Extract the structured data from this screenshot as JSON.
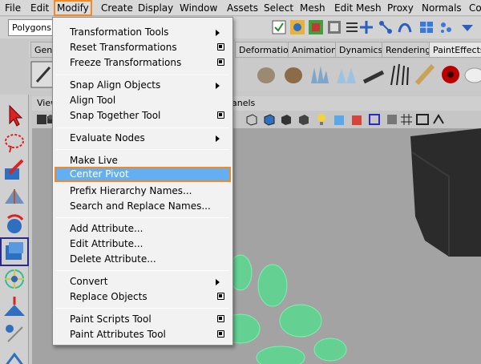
{
  "menubar": {
    "items": [
      "File",
      "Edit",
      "Modify",
      "Create",
      "Display",
      "Window",
      "Assets",
      "Select",
      "Mesh",
      "Edit Mesh",
      "Proxy",
      "Normals",
      "Co"
    ],
    "active": "Modify"
  },
  "toolbar": {
    "mode": "Polygons"
  },
  "shelf_tabs": [
    "Gene",
    "Deformation",
    "Animation",
    "Dynamics",
    "Rendering",
    "PaintEffects"
  ],
  "viewport": {
    "menu_view": "View",
    "menu_panels": "anels"
  },
  "modify_menu": {
    "items": [
      {
        "label": "Transformation Tools",
        "submenu": true
      },
      {
        "label": "Reset Transformations",
        "option_box": true
      },
      {
        "label": "Freeze Transformations",
        "option_box": true
      },
      {
        "label": "Snap Align Objects",
        "submenu": true
      },
      {
        "label": "Align Tool"
      },
      {
        "label": "Snap Together Tool",
        "option_box": true
      },
      {
        "label": "Evaluate Nodes",
        "submenu": true
      },
      {
        "label": "Make Live"
      },
      {
        "label": "Center Pivot",
        "highlighted": true
      },
      {
        "label": "Prefix Hierarchy Names..."
      },
      {
        "label": "Search and Replace Names..."
      },
      {
        "label": "Add Attribute..."
      },
      {
        "label": "Edit Attribute..."
      },
      {
        "label": "Delete Attribute..."
      },
      {
        "label": "Convert",
        "submenu": true
      },
      {
        "label": "Replace Objects",
        "option_box": true
      },
      {
        "label": "Paint Scripts Tool",
        "option_box": true
      },
      {
        "label": "Paint Attributes Tool",
        "option_box": true
      }
    ]
  },
  "colors": {
    "highlight": "#64aef2",
    "focus_outline": "#f08a24",
    "viewport_bg": "#a3a3a3"
  }
}
